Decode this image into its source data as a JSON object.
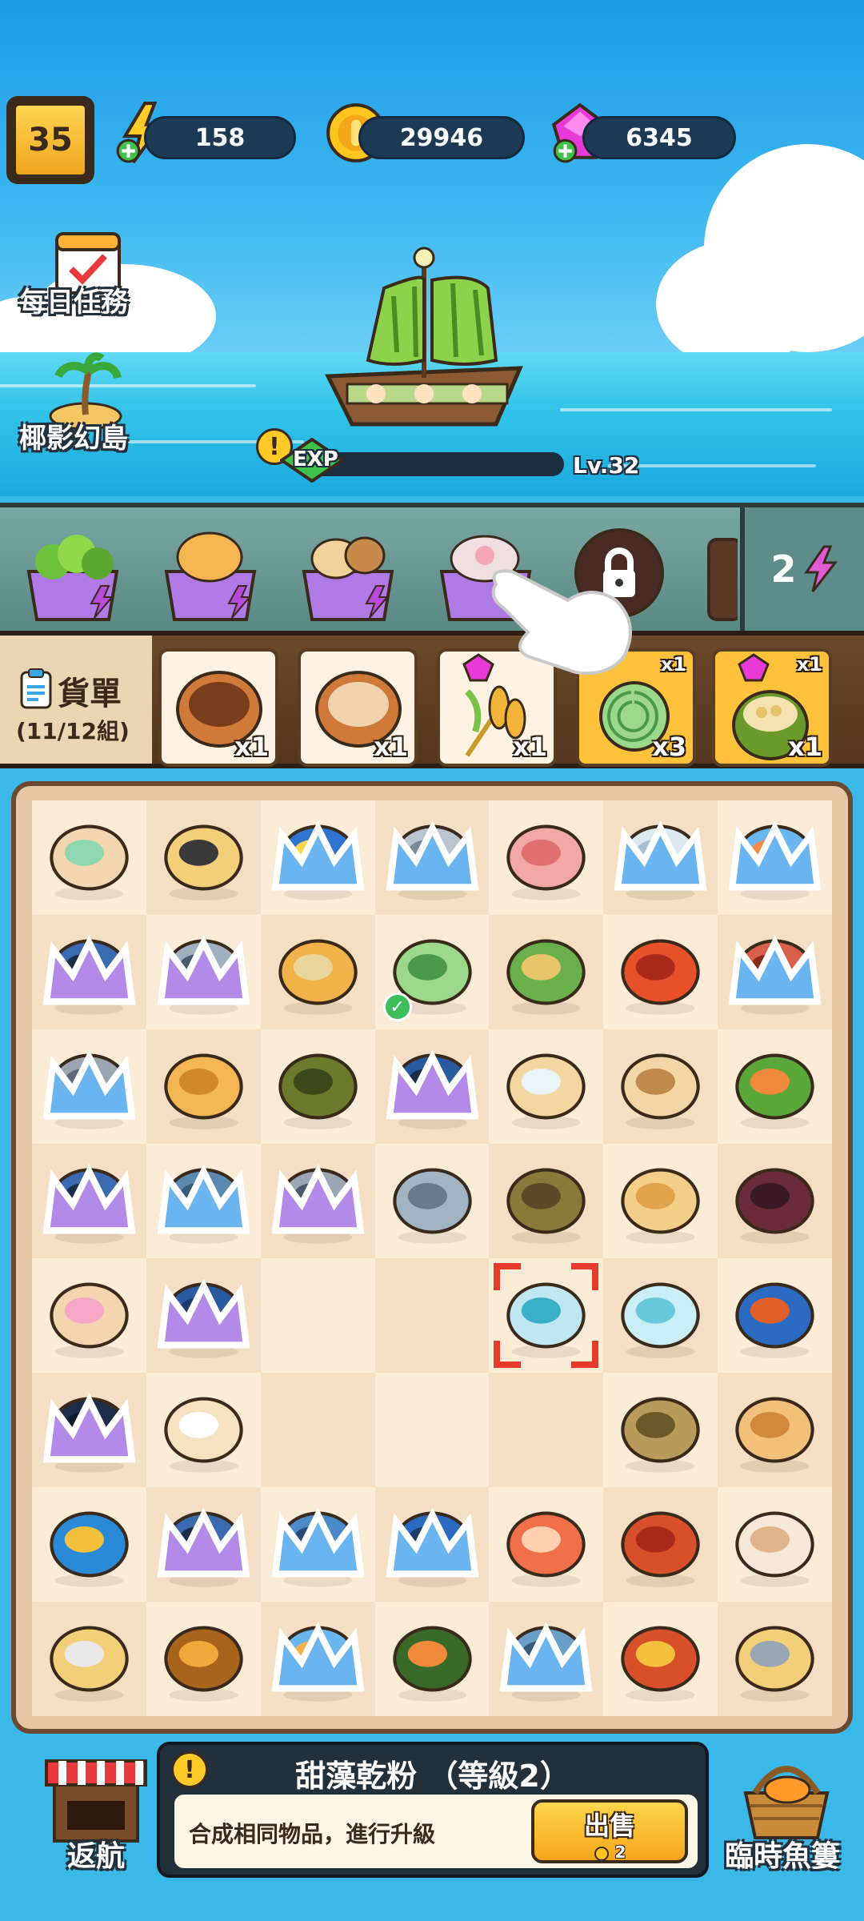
{
  "hud": {
    "level": "35",
    "energy": "158",
    "coins": "29946",
    "gems": "6345"
  },
  "side_buttons": {
    "daily_tasks": "每日任務",
    "island": "椰影幻島"
  },
  "ship": {
    "exp_label": "EXP",
    "level_label": "Lv.32",
    "exp_progress": 0.0
  },
  "generators": {
    "energy_cost": "2",
    "items": [
      "salad-bowl-generator",
      "shell-bowl-generator",
      "bread-bowl-generator",
      "pearl-bowl-generator",
      "locked-generator",
      "barrel-generator"
    ]
  },
  "orders": {
    "title": "貨單",
    "count": "(11/12組)",
    "cards": [
      {
        "item": "brown-sauce-bowl",
        "qty": "x1",
        "ready": false
      },
      {
        "item": "oyster-plate",
        "qty": "x1",
        "ready": false
      },
      {
        "item": "wheat",
        "qty": "x1",
        "need": "x",
        "ready": false
      },
      {
        "item": "green-ammonite",
        "qty": "x3",
        "need": "x1",
        "ready": true
      },
      {
        "item": "coconut-bowl",
        "qty": "x1",
        "need": "x1",
        "ready": true
      }
    ]
  },
  "board": {
    "rows": [
      [
        "green-soup-bowl",
        "black-rock-sand",
        "angelfish",
        "grey-puffer",
        "octopus",
        "white-fish",
        "colorful-fish"
      ],
      [
        "blue-pipe",
        "wrench",
        "corn-cob",
        "ammonite",
        "leaf-wrap",
        "red-crab",
        "red-fish-head"
      ],
      [
        "grey-fish",
        "scallop-shell",
        "green-vase",
        "blue-rod",
        "open-pearl-shell",
        "oyster",
        "leaf-wrap-2"
      ],
      [
        "chopsticks",
        "stingray-small",
        "screw",
        "fish-bone",
        "brown-bottle",
        "scallop-open",
        "purple-bottle"
      ],
      [
        "candy-bowl",
        "blue-crystals",
        "",
        "",
        "blue-sand-bottle",
        "sugar-jar",
        "blue-red-fish"
      ],
      [
        "dark-tube",
        "sugar-pile",
        "",
        "",
        "",
        "conch",
        "spiral-shell"
      ],
      [
        "blue-yellow-fish",
        "hex-nut",
        "blue-tuna",
        "dolphin-fish",
        "shrimp",
        "king-crab",
        "white-clam"
      ],
      [
        "sand-bucket",
        "honey-jar",
        "spotted-fish",
        "seaweed-star",
        "manta-ray",
        "king-crab-2",
        "shell-sand"
      ]
    ]
  },
  "info_panel": {
    "title": "甜藻乾粉 （等級2）",
    "text": "合成相同物品，進行升級",
    "sell_label": "出售",
    "sell_price": "2"
  },
  "bottom": {
    "return_label": "返航",
    "basket_label": "臨時魚簍"
  },
  "colors": {
    "sky": "#1e9be6",
    "panel_dark": "#22303c",
    "gold": "#ffc23a",
    "selection": "#e63b2a"
  }
}
